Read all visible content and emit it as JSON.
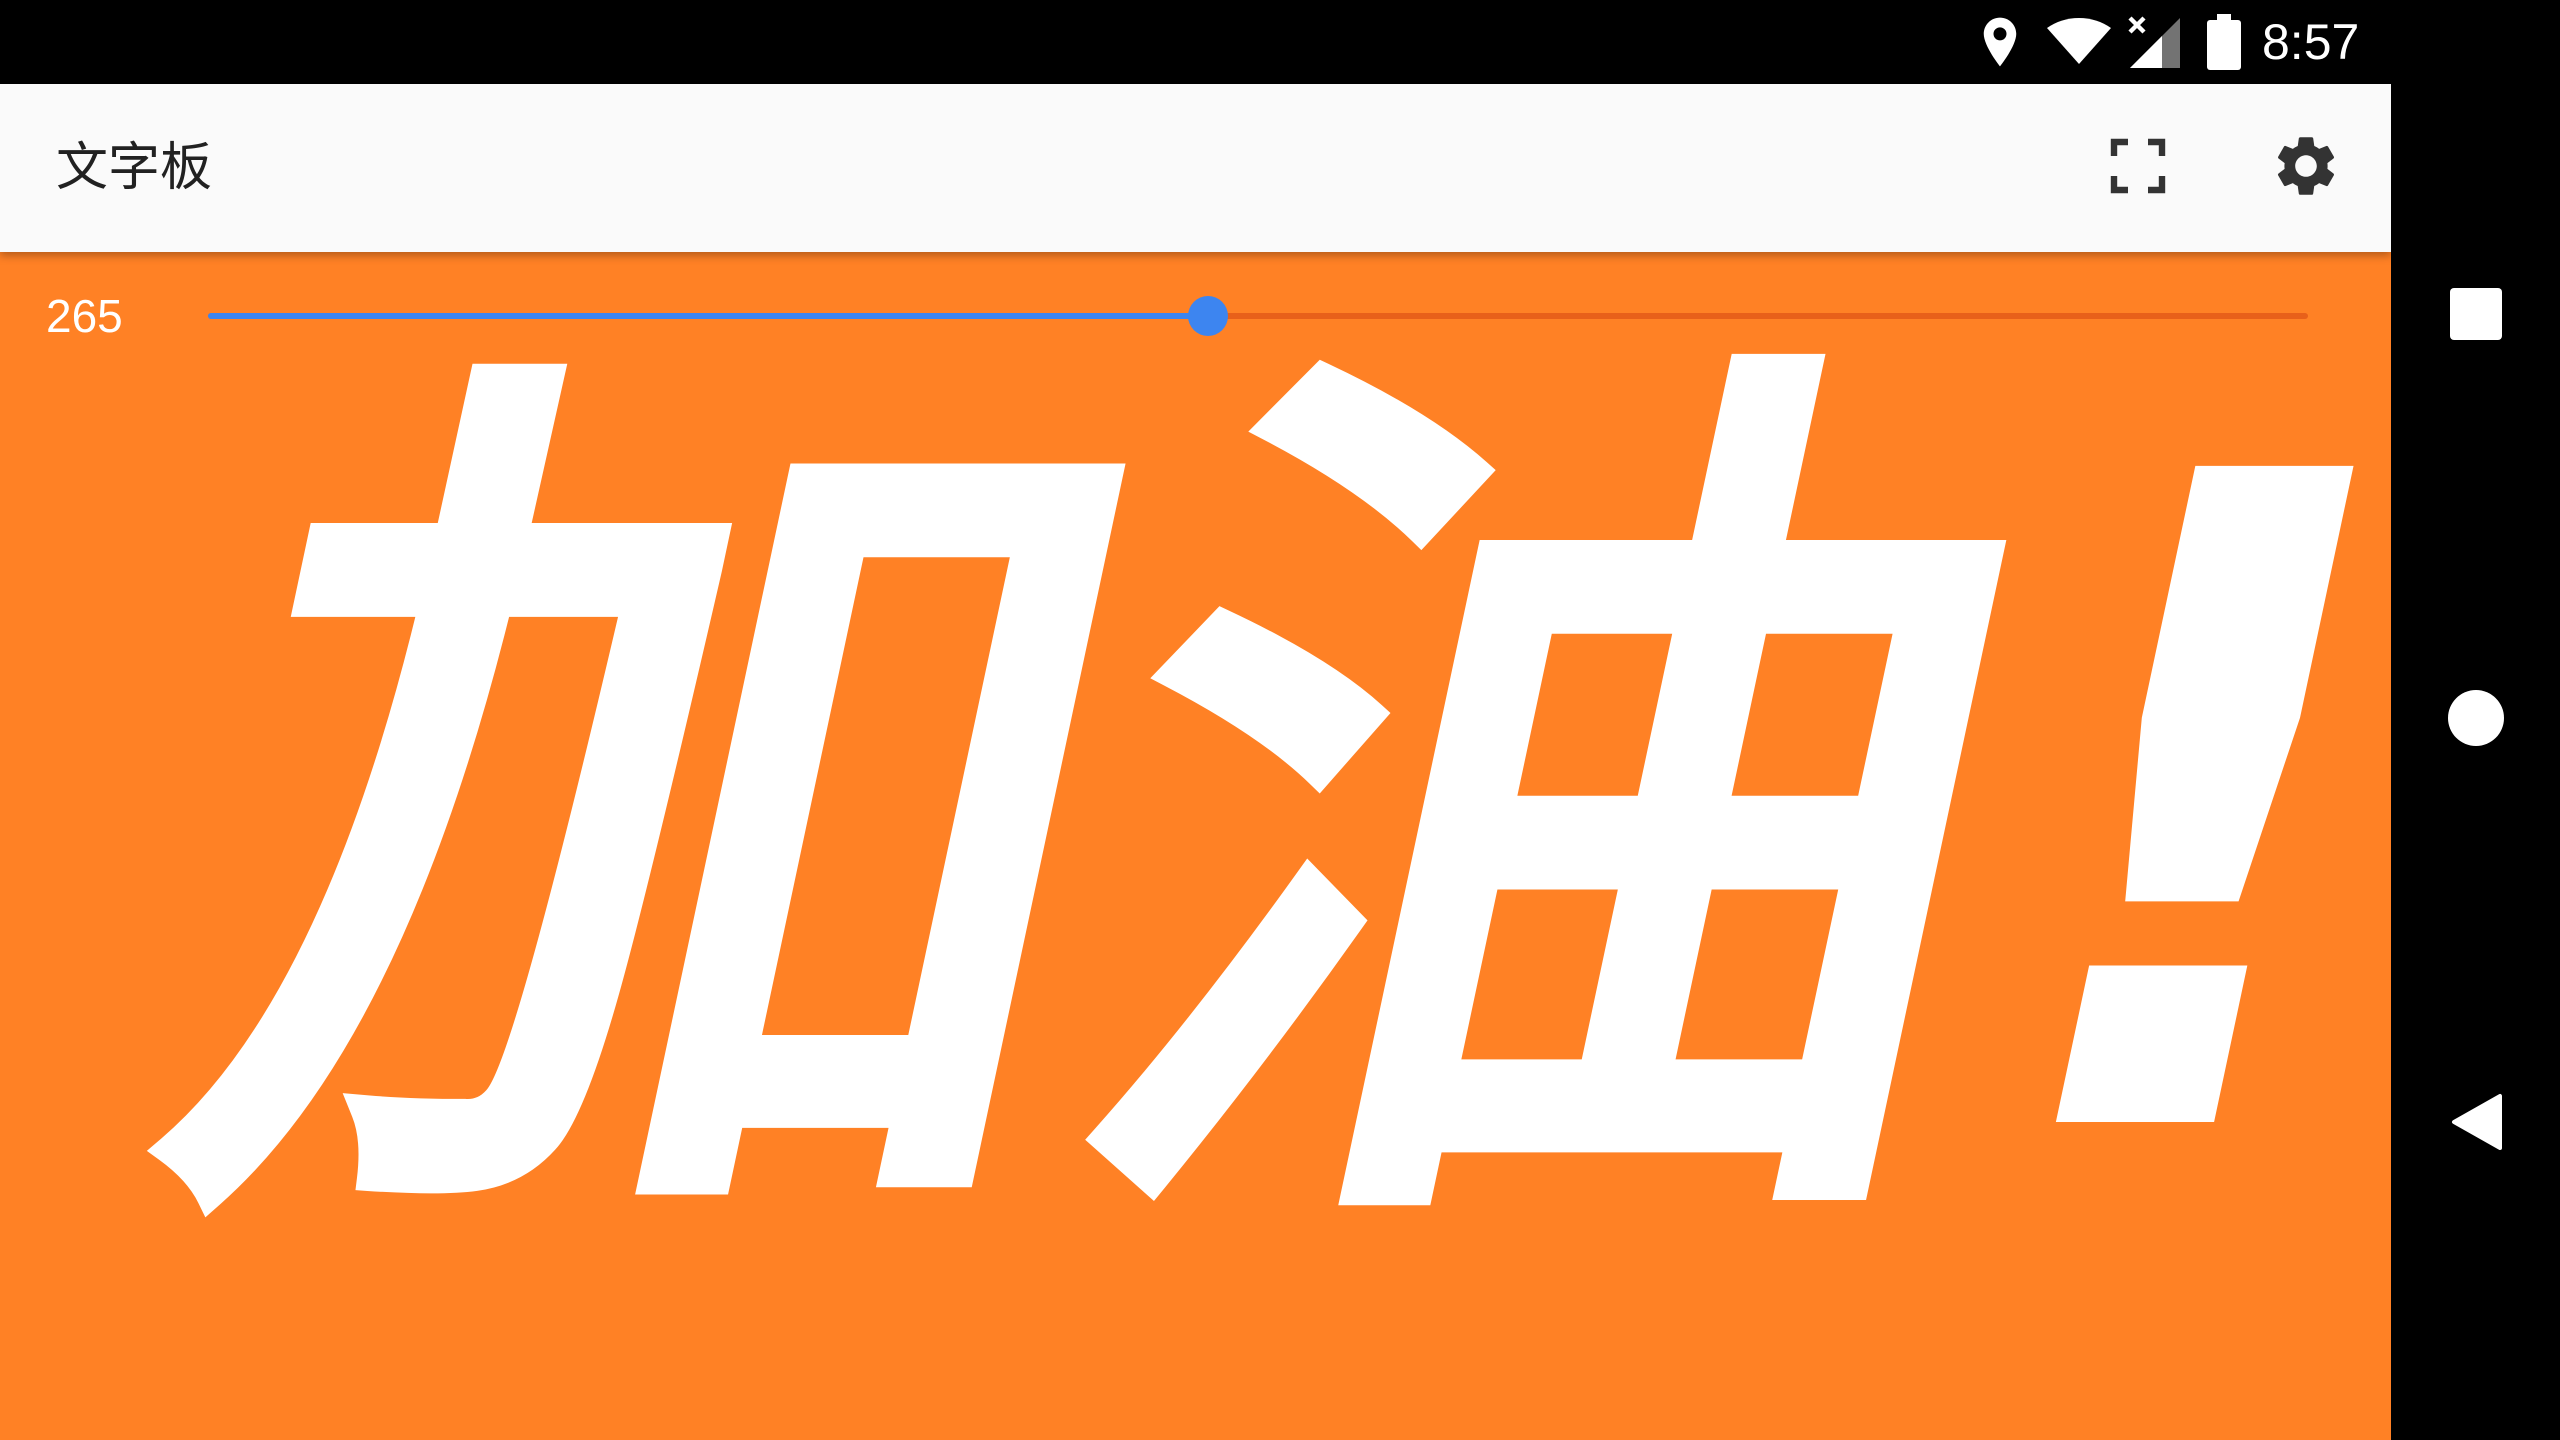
{
  "status_bar": {
    "time": "8:57",
    "icons": [
      "location-icon",
      "wifi-icon",
      "cell-signal-icon",
      "battery-icon"
    ]
  },
  "app_bar": {
    "title": "文字板",
    "actions": [
      "fullscreen-icon",
      "settings-icon"
    ]
  },
  "size_slider": {
    "value_label": "265",
    "fill_fraction": 0.476
  },
  "board": {
    "text": "加油!",
    "background_color": "#ff8125",
    "text_color": "#ffffff"
  },
  "nav_bar": {
    "buttons": [
      "recents-icon",
      "home-icon",
      "back-icon"
    ]
  },
  "colors": {
    "accent": "#3d85f0",
    "app_bar": "#fafafa"
  }
}
